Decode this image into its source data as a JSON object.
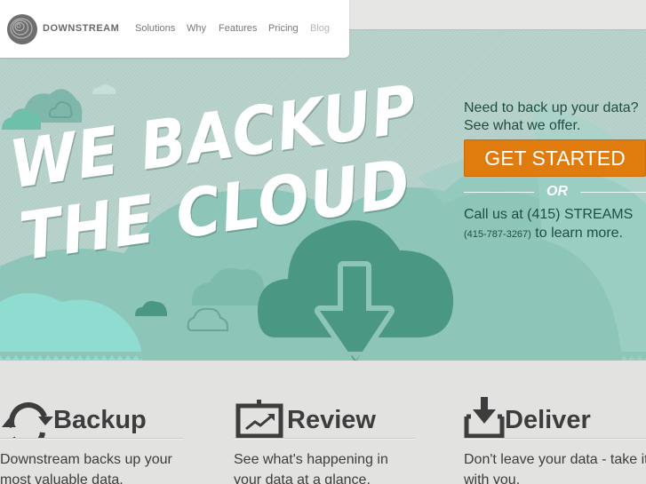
{
  "nav": {
    "brand": "DOWNSTREAM",
    "logo_icon": "spiral-logo-icon",
    "links": [
      {
        "label": "Solutions",
        "muted": false
      },
      {
        "label": "Why",
        "muted": false
      },
      {
        "label": "Features",
        "muted": false
      },
      {
        "label": "Pricing",
        "muted": false
      },
      {
        "label": "Blog",
        "muted": true
      }
    ]
  },
  "hero": {
    "headline_line1": "WE BACKUP",
    "headline_line2": "THE CLOUD",
    "hero_icon": "cloud-download-icon",
    "cta": {
      "tagline_line1": "Need to back up your data?",
      "tagline_line2": "See what we offer.",
      "button_label": "GET STARTED",
      "or_label": "OR",
      "call_line1": "Call us at (415) STREAMS",
      "call_phone": "(415-787-3267)",
      "call_suffix": " to learn more."
    }
  },
  "features": [
    {
      "icon": "sync-arrows-icon",
      "title": "Backup",
      "desc": "Downstream backs up your most valuable data."
    },
    {
      "icon": "chart-board-icon",
      "title": "Review",
      "desc": "See what's happening in your data at a glance."
    },
    {
      "icon": "download-tray-icon",
      "title": "Deliver",
      "desc": "Don't leave your data - take it with you."
    }
  ],
  "colors": {
    "accent_orange": "#e07b0d",
    "hero_teal": "#8dc6b8",
    "dark_teal": "#4a9784",
    "text_dark": "#3d3d3d"
  }
}
